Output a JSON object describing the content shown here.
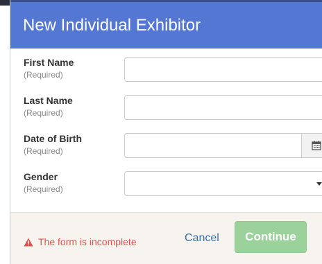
{
  "dialog": {
    "title": "New Individual Exhibitor"
  },
  "form": {
    "fields": [
      {
        "label": "First Name",
        "required_label": "(Required)",
        "value": ""
      },
      {
        "label": "Last Name",
        "required_label": "(Required)",
        "value": ""
      },
      {
        "label": "Date of Birth",
        "required_label": "(Required)",
        "value": ""
      },
      {
        "label": "Gender",
        "required_label": "(Required)",
        "value": ""
      }
    ]
  },
  "footer": {
    "status_text": "The form is incomplete",
    "cancel_label": "Cancel",
    "continue_label": "Continue"
  },
  "icons": {
    "calendar": "calendar-icon",
    "warning": "warning-triangle-icon",
    "dropdown": "caret-down-icon"
  },
  "colors": {
    "header": "#5477d4",
    "error": "#d9534f",
    "link": "#3a6fb0",
    "continue_disabled": "#9bd19b"
  }
}
